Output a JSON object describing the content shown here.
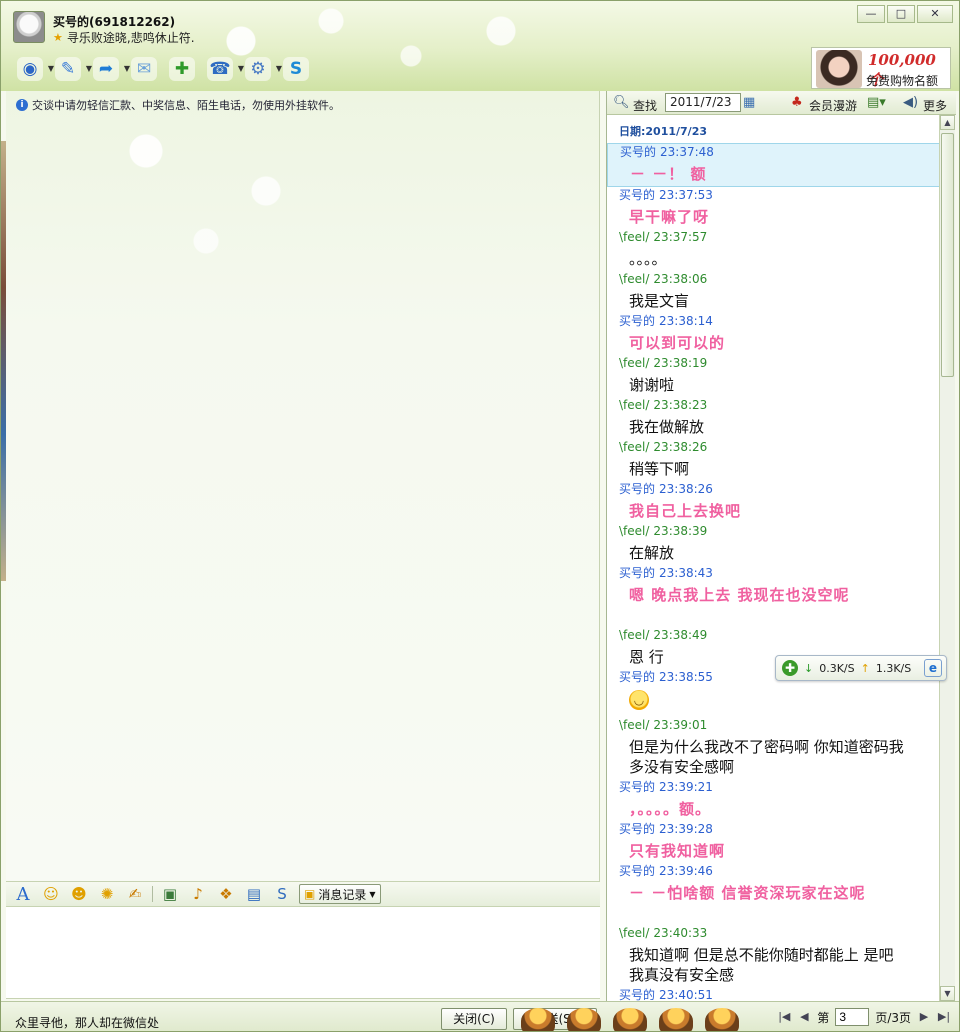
{
  "header": {
    "contact_name": "买号的(691812262)",
    "signature": "寻乐败途晓,悲鸣休止符.",
    "window_buttons": {
      "minimize": "—",
      "maximize": "□",
      "close": "✕"
    }
  },
  "toolbar": {
    "tools": [
      {
        "name": "video-call",
        "glyph": "◉"
      },
      {
        "name": "voice-call",
        "glyph": "✎"
      },
      {
        "name": "send-file",
        "glyph": "➦"
      },
      {
        "name": "send-sms",
        "glyph": "✉"
      },
      {
        "name": "create-group",
        "glyph": "✚"
      },
      {
        "name": "remote-assist",
        "glyph": "☎"
      },
      {
        "name": "app-settings",
        "glyph": "⚙"
      },
      {
        "name": "soso",
        "glyph": "S"
      }
    ]
  },
  "ad": {
    "number": "100,000个",
    "text": "免费购物名额"
  },
  "notice": "交谈中请勿轻信汇款、中奖信息、陌生电话，勿使用外挂软件。",
  "history_toolbar": {
    "search_label": "查找",
    "date_value": "2011/7/23",
    "vip_label": "会员漫游",
    "more_label": "更多"
  },
  "log": {
    "date_header": "日期:2011/7/23",
    "messages": [
      {
        "sender": "买号的",
        "time": "23:37:48",
        "text": "－ －！ 额",
        "style": "pink",
        "role": "me",
        "selected": true
      },
      {
        "sender": "买号的",
        "time": "23:37:53",
        "text": "早干嘛了呀",
        "style": "pink",
        "role": "me"
      },
      {
        "sender": "\\feel/",
        "time": "23:37:57",
        "text": "。。。。",
        "style": "plain",
        "role": "peer"
      },
      {
        "sender": "\\feel/",
        "time": "23:38:06",
        "text": "我是文盲",
        "style": "plain",
        "role": "peer"
      },
      {
        "sender": "买号的",
        "time": "23:38:14",
        "text": "可以到可以的",
        "style": "pink",
        "role": "me"
      },
      {
        "sender": "\\feel/",
        "time": "23:38:19",
        "text": "谢谢啦",
        "style": "plain",
        "role": "peer"
      },
      {
        "sender": "\\feel/",
        "time": "23:38:23",
        "text": "我在做解放",
        "style": "plain",
        "role": "peer"
      },
      {
        "sender": "\\feel/",
        "time": "23:38:26",
        "text": "稍等下啊",
        "style": "plain",
        "role": "peer"
      },
      {
        "sender": "买号的",
        "time": "23:38:26",
        "text": "我自己上去换吧",
        "style": "pink",
        "role": "me"
      },
      {
        "sender": "\\feel/",
        "time": "23:38:39",
        "text": "在解放",
        "style": "plain",
        "role": "peer"
      },
      {
        "sender": "买号的",
        "time": "23:38:43",
        "text": "嗯  晚点我上去  我现在也没空呢",
        "style": "pink",
        "role": "me"
      },
      {
        "sender": "\\feel/",
        "time": "23:38:49",
        "text": "恩 行",
        "style": "plain",
        "role": "peer"
      },
      {
        "sender": "买号的",
        "time": "23:38:55",
        "text": "",
        "style": "smile",
        "role": "me"
      },
      {
        "sender": "\\feel/",
        "time": "23:39:01",
        "text": "但是为什么我改不了密码啊  你知道密码我多没有安全感啊",
        "style": "plain",
        "role": "peer"
      },
      {
        "sender": "买号的",
        "time": "23:39:21",
        "text": "，。。。。额。",
        "style": "pink",
        "role": "me"
      },
      {
        "sender": "买号的",
        "time": "23:39:28",
        "text": "只有我知道啊",
        "style": "pink",
        "role": "me"
      },
      {
        "sender": "买号的",
        "time": "23:39:46",
        "text": "－ －怕啥额  信誉资深玩家在这呢",
        "style": "pink",
        "role": "me"
      },
      {
        "sender": "\\feel/",
        "time": "23:40:33",
        "text": "我知道啊    但是总不能你随时都能上  是吧 我真没有安全感",
        "style": "plain",
        "role": "peer"
      },
      {
        "sender": "买号的",
        "time": "23:40:51",
        "text": "",
        "style": "pink",
        "role": "me"
      }
    ]
  },
  "net_widget": {
    "down": "0.3K/S",
    "up": "1.3K/S"
  },
  "format_bar": {
    "history_label": "消息记录"
  },
  "bottom": {
    "status_text": "众里寻他，那人却在微信处",
    "close_label": "关闭(C)",
    "send_label": "发送(S)",
    "pager_prefix": "第",
    "page_value": "3",
    "pager_suffix": "页/3页"
  },
  "colors": {
    "pink_text": "#f060a0",
    "me_meta": "#2b5fd0",
    "peer_meta": "#2e8b2e",
    "frame": "#8aa06a"
  }
}
